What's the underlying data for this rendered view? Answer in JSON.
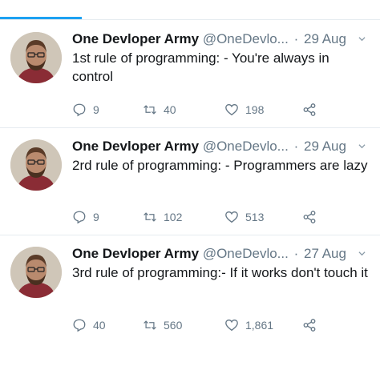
{
  "tweets": [
    {
      "display_name": "One Devloper Army",
      "handle": "@OneDevlo...",
      "separator": "·",
      "date": "29 Aug",
      "text": "1st rule of programming: - You're always in control",
      "replies": "9",
      "retweets": "40",
      "likes": "198",
      "icons": {
        "reply": "reply-icon",
        "retweet": "retweet-icon",
        "like": "heart-icon",
        "share": "share-icon",
        "caret": "chevron-down-icon"
      }
    },
    {
      "display_name": "One Devloper Army",
      "handle": "@OneDevlo...",
      "separator": "·",
      "date": "29 Aug",
      "text": "2rd rule of programming: - Programmers are lazy",
      "replies": "9",
      "retweets": "102",
      "likes": "513",
      "icons": {
        "reply": "reply-icon",
        "retweet": "retweet-icon",
        "like": "heart-icon",
        "share": "share-icon",
        "caret": "chevron-down-icon"
      }
    },
    {
      "display_name": "One Devloper Army",
      "handle": "@OneDevlo...",
      "separator": "·",
      "date": "27 Aug",
      "text": "3rd rule of programming:-  If it works don't touch it",
      "replies": "40",
      "retweets": "560",
      "likes": "1,861",
      "icons": {
        "reply": "reply-icon",
        "retweet": "retweet-icon",
        "like": "heart-icon",
        "share": "share-icon",
        "caret": "chevron-down-icon"
      }
    }
  ],
  "colors": {
    "accent": "#1da1f2",
    "text": "#14171a",
    "muted": "#657786",
    "divider": "#e6ecf0"
  }
}
